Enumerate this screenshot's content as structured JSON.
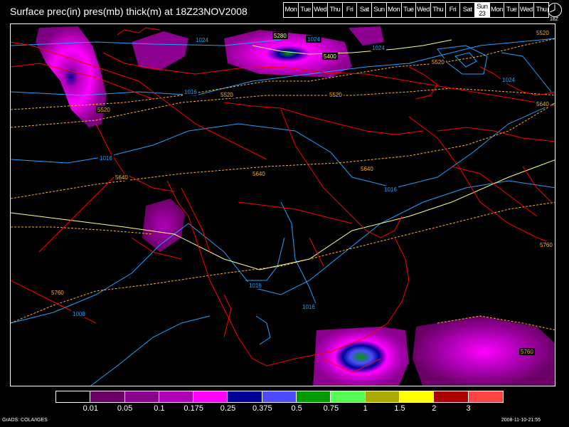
{
  "title": "Surface prec(in) pres(mb) thick(m) at 18Z23NOV2008",
  "day_strip": [
    {
      "label": "Mon"
    },
    {
      "label": "Tue"
    },
    {
      "label": "Wed"
    },
    {
      "label": "Thu"
    },
    {
      "label": "Fri"
    },
    {
      "label": "Sat"
    },
    {
      "label": "Sun"
    },
    {
      "label": "Mon"
    },
    {
      "label": "Tue"
    },
    {
      "label": "Wed"
    },
    {
      "label": "Thu"
    },
    {
      "label": "Fri"
    },
    {
      "label": "Sat"
    },
    {
      "label": "Sun",
      "day": "23",
      "current": true
    },
    {
      "label": "Mon"
    },
    {
      "label": "Tue"
    },
    {
      "label": "Wed"
    },
    {
      "label": "Thu"
    }
  ],
  "clock_label": "18Z",
  "colorbar": {
    "colors": [
      "#000000",
      "#6a0066",
      "#8c0090",
      "#b000b8",
      "#ff00ff",
      "#000099",
      "#4d4dff",
      "#009900",
      "#55ff55",
      "#aaaa00",
      "#ffff00",
      "#aa0000",
      "#ff4444"
    ],
    "labels": [
      "0.01",
      "0.05",
      "0.1",
      "0.175",
      "0.25",
      "0.375",
      "0.5",
      "0.75",
      "1",
      "1.5",
      "2",
      "3"
    ]
  },
  "footer_left": "GrADS: COLA/IGES",
  "footer_right": "2008-11-10-21:55",
  "map": {
    "isobar_color": "#20a0ff",
    "thickness_color": "#ffb020",
    "thickness_540_color": "#ffff80",
    "border_color": "#ff0000",
    "labels": [
      {
        "text": "1024"
      },
      {
        "text": "1016"
      },
      {
        "text": "1016"
      },
      {
        "text": "1016"
      },
      {
        "text": "1016"
      },
      {
        "text": "1016"
      },
      {
        "text": "1008"
      },
      {
        "text": "1024"
      },
      {
        "text": "1024"
      },
      {
        "text": "1024"
      },
      {
        "text": "5520"
      },
      {
        "text": "5520"
      },
      {
        "text": "5520"
      },
      {
        "text": "5520"
      },
      {
        "text": "5520"
      },
      {
        "text": "5640"
      },
      {
        "text": "5640"
      },
      {
        "text": "5640"
      },
      {
        "text": "5640"
      },
      {
        "text": "5760"
      },
      {
        "text": "5760"
      },
      {
        "text": "5760"
      },
      {
        "text": "5280"
      },
      {
        "text": "5400"
      }
    ]
  }
}
